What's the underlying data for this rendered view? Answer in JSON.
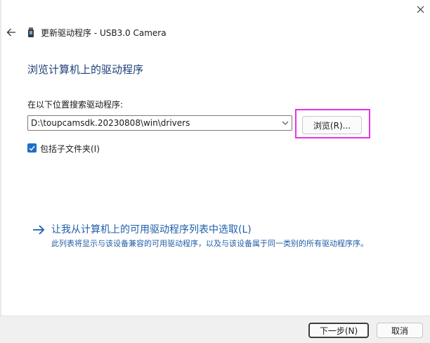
{
  "window": {
    "title": "更新驱动程序 - USB3.0 Camera"
  },
  "page": {
    "title": "浏览计算机上的驱动程序",
    "search_label": "在以下位置搜索驱动程序:",
    "path_value": "D:\\toupcamsdk.20230808\\win\\drivers",
    "browse_label": "浏览(R)...",
    "include_subfolders_label": "包括子文件夹(I)",
    "include_subfolders_checked": true
  },
  "pick_option": {
    "title": "让我从计算机上的可用驱动程序列表中选取(L)",
    "description": "此列表将显示与该设备兼容的可用驱动程序，以及与该设备属于同一类别的所有驱动程序序。"
  },
  "footer": {
    "next_label": "下一步(N)",
    "cancel_label": "取消"
  },
  "icons": {
    "close": "close-icon",
    "back": "back-arrow-icon",
    "device": "usb-device-icon",
    "dropdown": "chevron-down-icon",
    "checkbox": "checkmark-icon",
    "link_arrow": "arrow-right-icon"
  },
  "colors": {
    "accent": "#1f6fc5",
    "link": "#1f5fa8",
    "title": "#1f3f7a",
    "highlight": "#e333e3"
  }
}
